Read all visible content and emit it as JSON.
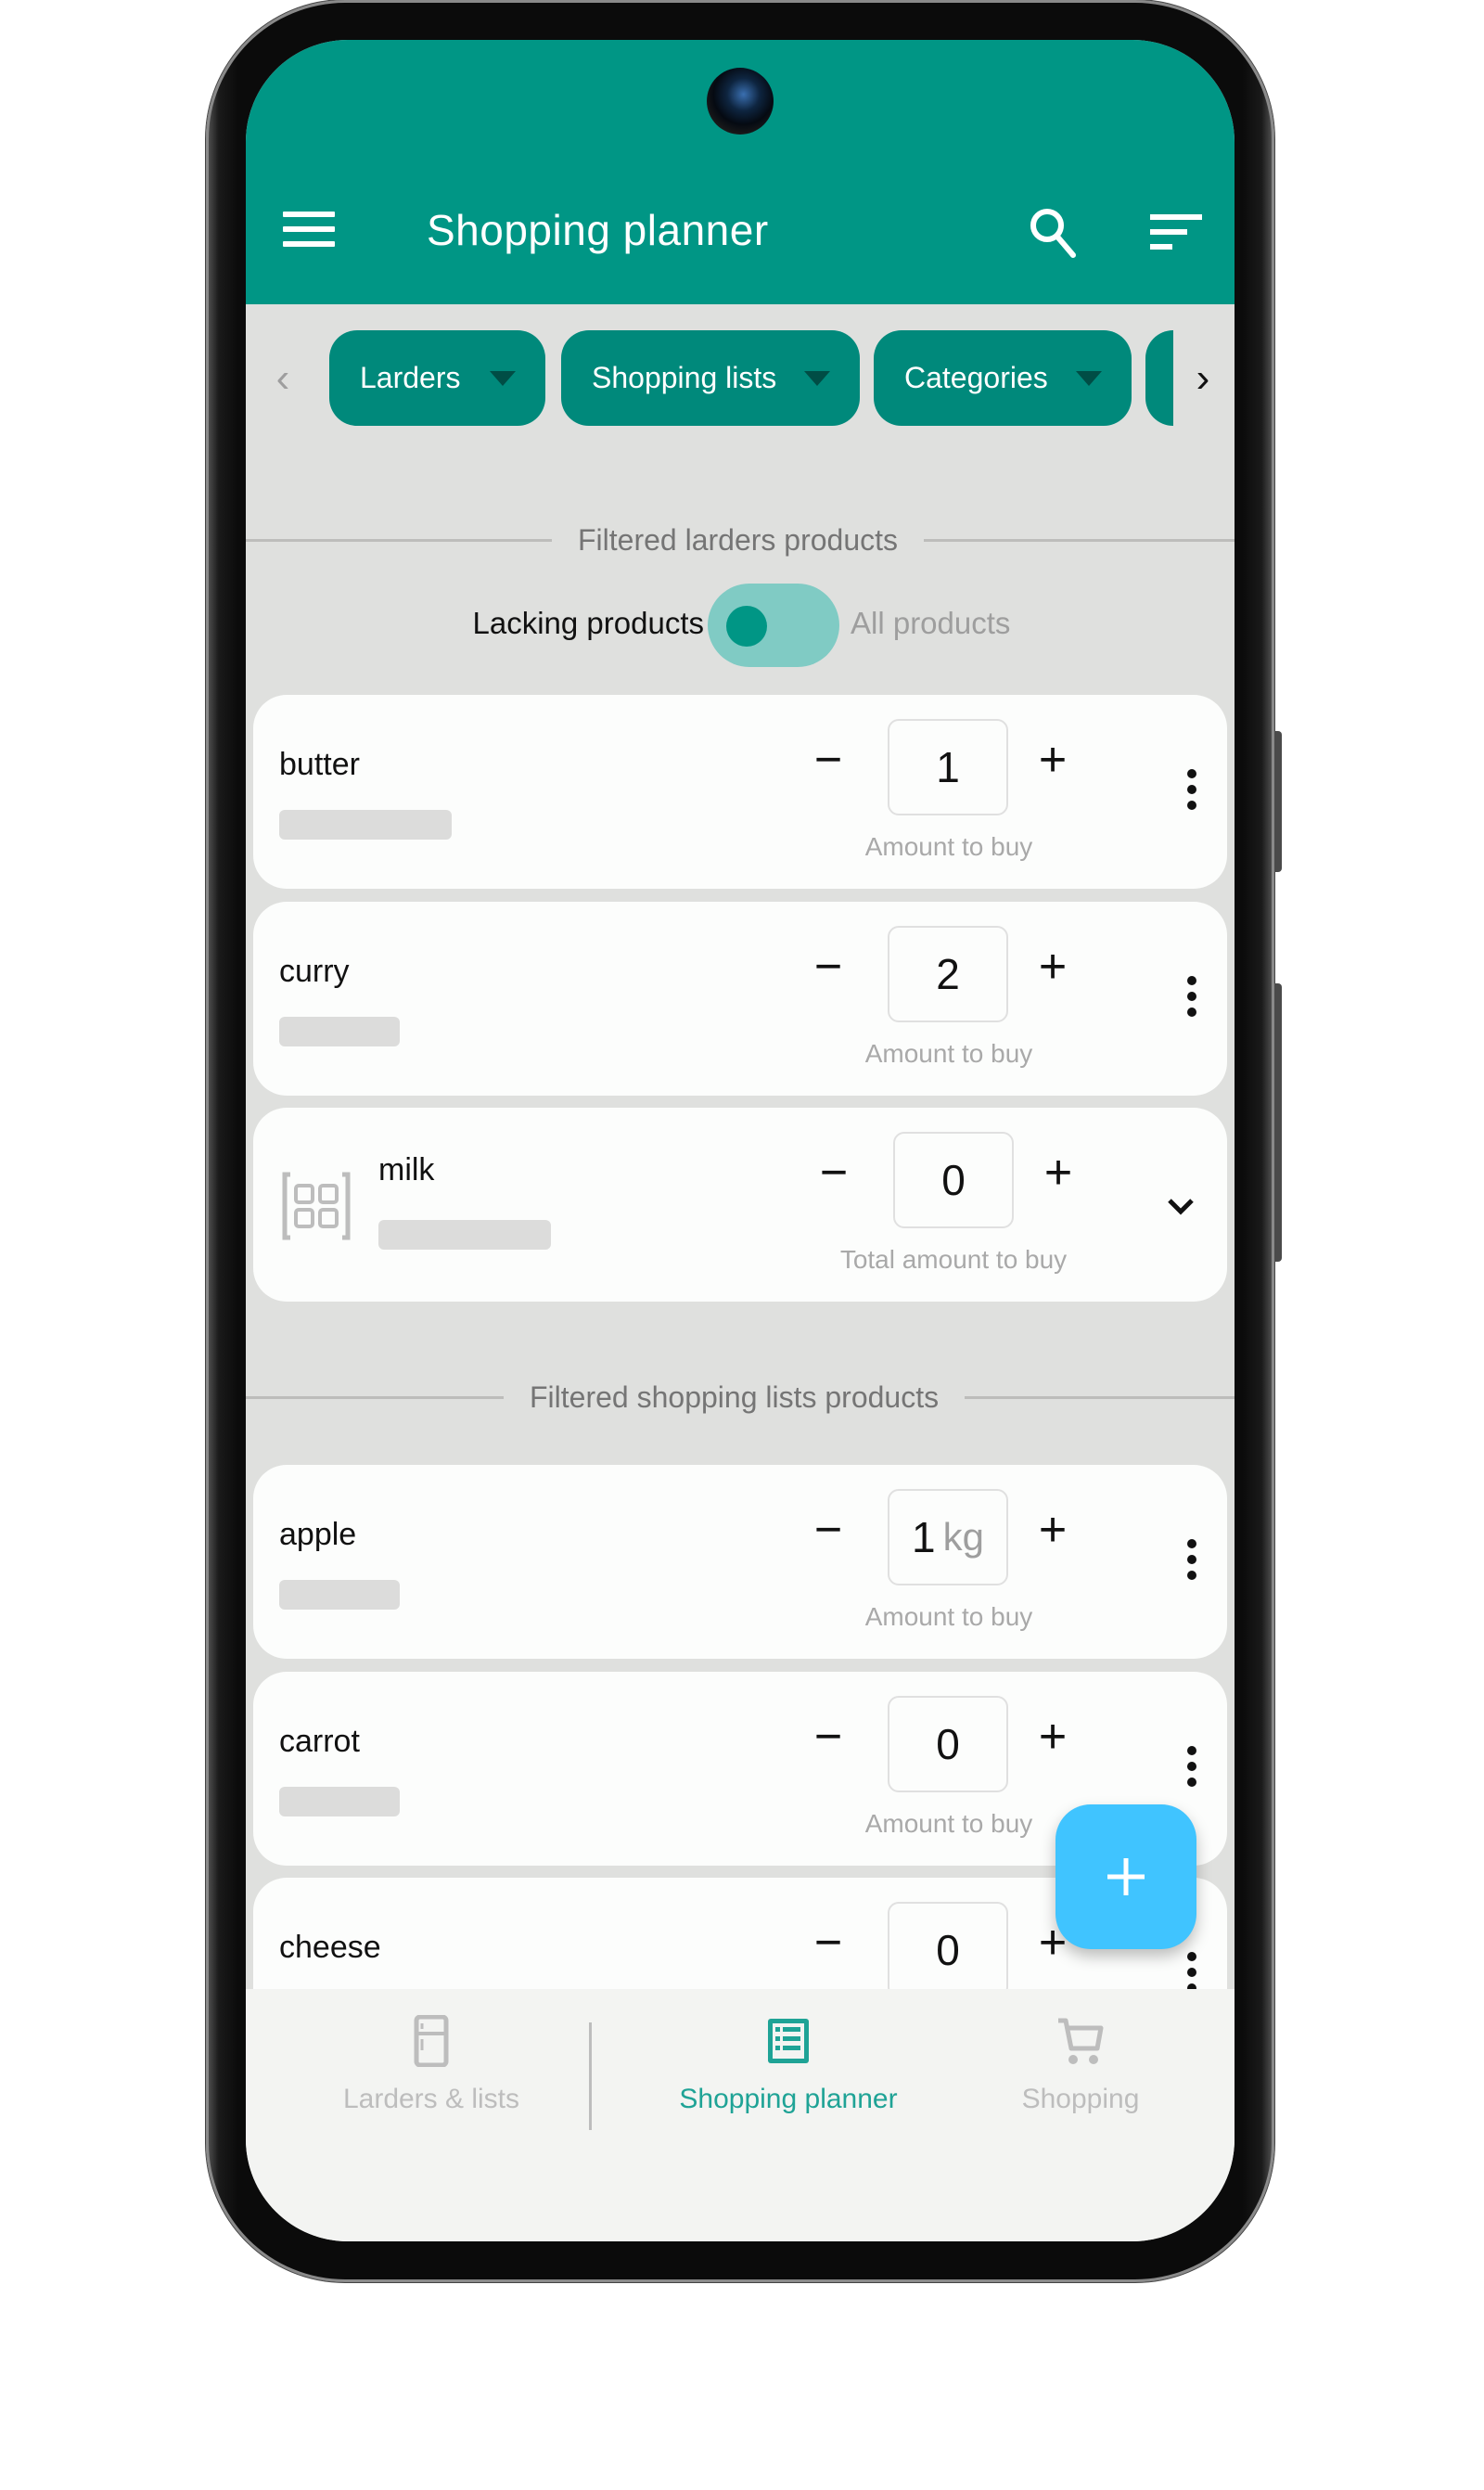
{
  "app": {
    "title": "Shopping planner"
  },
  "appbar": {
    "menu_icon": "hamburger-menu-icon",
    "search_icon": "search-icon",
    "sort_icon": "sort-filter-icon"
  },
  "filter_chips": {
    "scroll_left_icon": "chevron-left-icon",
    "scroll_right_icon": "chevron-right-icon",
    "items": [
      {
        "label": "Larders"
      },
      {
        "label": "Shopping lists"
      },
      {
        "label": "Categories"
      }
    ]
  },
  "larders_section": {
    "title": "Filtered larders products",
    "toggle": {
      "left_label": "Lacking products",
      "right_label": "All products",
      "selected": "Lacking products"
    },
    "products": [
      {
        "name": "butter",
        "quantity": "1",
        "unit": "",
        "hint": "Amount to buy",
        "action_icon": "more-vert-icon"
      },
      {
        "name": "curry",
        "quantity": "2",
        "unit": "",
        "hint": "Amount to buy",
        "action_icon": "more-vert-icon"
      },
      {
        "name": "milk",
        "quantity": "0",
        "unit": "",
        "hint": "Total amount to buy",
        "action_icon": "expand-more-icon",
        "grouped": true
      }
    ]
  },
  "shopping_lists_section": {
    "title": "Filtered shopping lists products",
    "products": [
      {
        "name": "apple",
        "quantity": "1",
        "unit": "kg",
        "hint": "Amount to buy",
        "action_icon": "more-vert-icon"
      },
      {
        "name": "carrot",
        "quantity": "0",
        "unit": "",
        "hint": "Amount to buy",
        "action_icon": "more-vert-icon"
      },
      {
        "name": "cheese",
        "quantity": "0",
        "unit": "",
        "hint": "",
        "action_icon": "more-vert-icon"
      }
    ]
  },
  "stepper": {
    "minus": "−",
    "plus": "+"
  },
  "fab": {
    "icon": "add-icon",
    "color": "#40c4ff"
  },
  "bottom_nav": {
    "items": [
      {
        "label": "Larders & lists",
        "icon": "fridge-icon",
        "active": false
      },
      {
        "label": "Shopping planner",
        "icon": "list-icon",
        "active": true
      },
      {
        "label": "Shopping",
        "icon": "cart-icon",
        "active": false
      }
    ]
  },
  "colors": {
    "primary": "#009685",
    "chip": "#00897b",
    "toggle_track": "#80cbc4",
    "background": "#dfe0de",
    "card": "#fcfdfc",
    "active_nav": "#1fa396",
    "inactive_nav": "#bdbdbd"
  }
}
